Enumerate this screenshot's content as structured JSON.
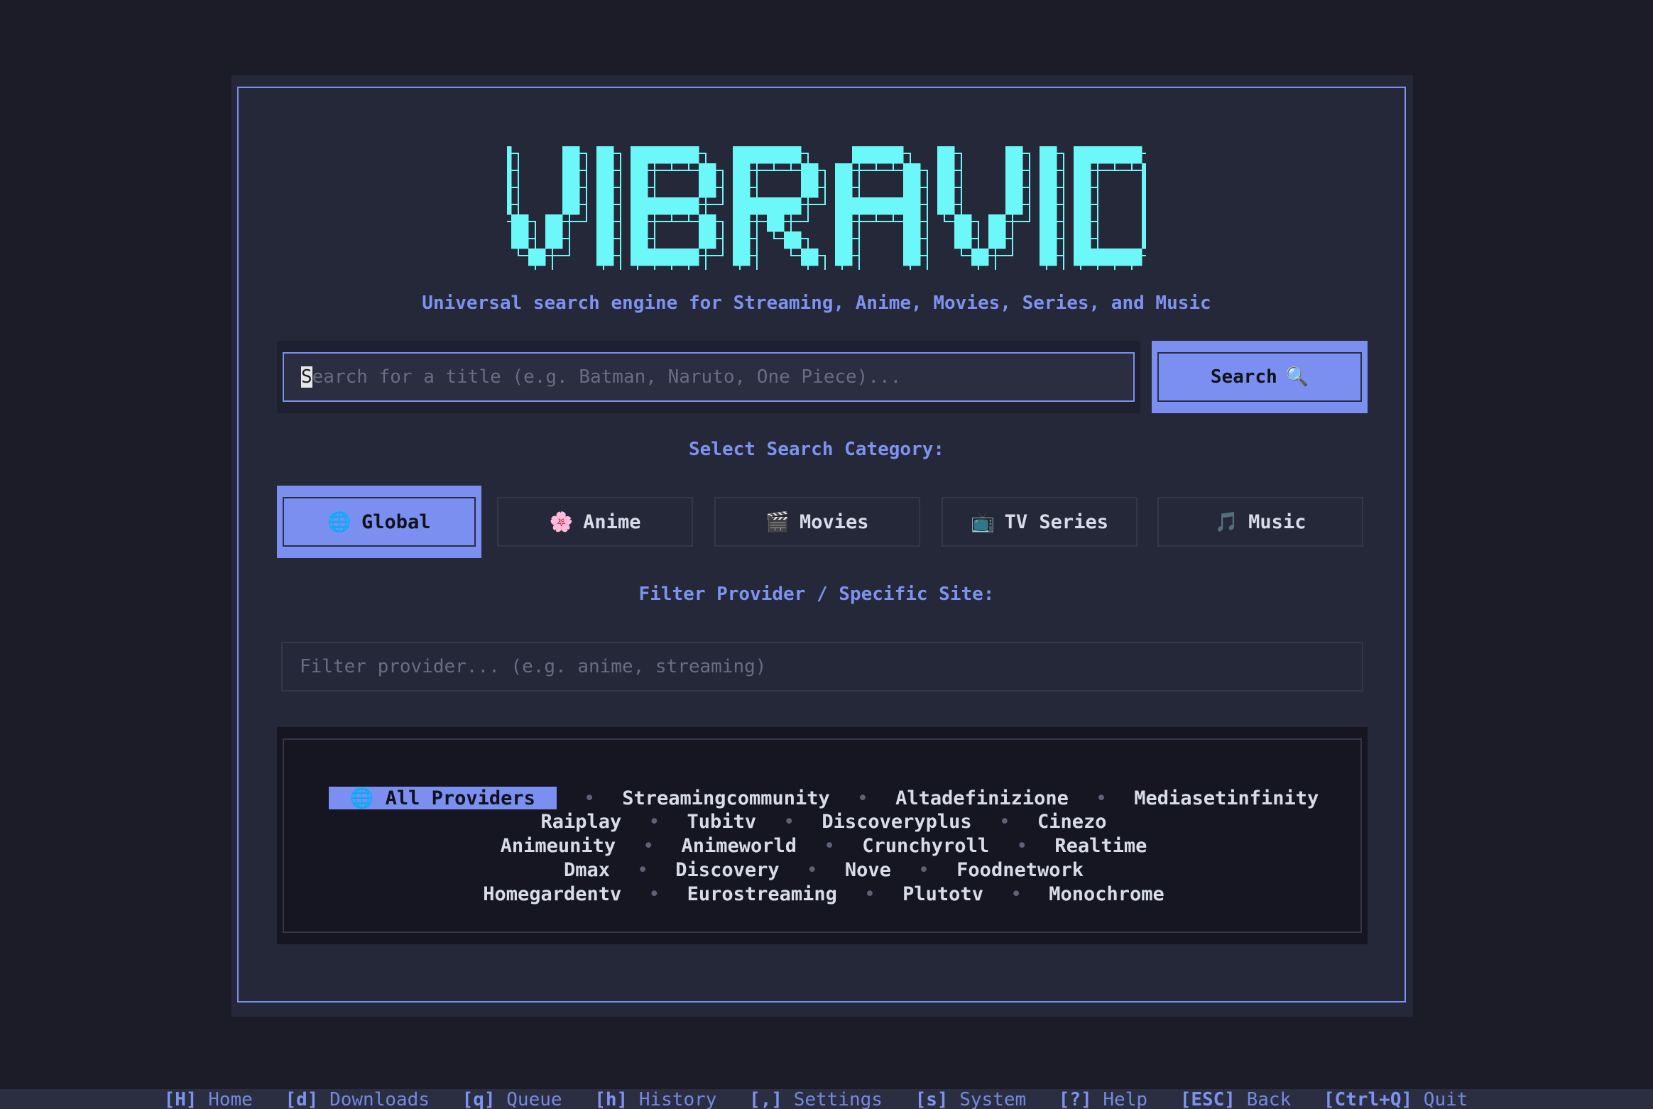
{
  "app": {
    "logo_text": "VIBRAVID",
    "subtitle": "Universal search engine for Streaming, Anime, Movies, Series, and Music"
  },
  "search": {
    "placeholder_first": "S",
    "placeholder_rest": "earch for a title (e.g. Batman, Naruto, One Piece)...",
    "button_label": "Search",
    "button_icon": "🔍"
  },
  "categories": {
    "label": "Select Search Category:",
    "items": [
      {
        "icon": "🌐",
        "label": "Global",
        "active": true
      },
      {
        "icon": "🌸",
        "label": "Anime",
        "active": false
      },
      {
        "icon": "🎬",
        "label": "Movies",
        "active": false
      },
      {
        "icon": "📺",
        "label": "TV Series",
        "active": false
      },
      {
        "icon": "🎵",
        "label": "Music",
        "active": false
      }
    ]
  },
  "filter": {
    "label": "Filter Provider / Specific Site:",
    "placeholder": "Filter provider... (e.g. anime, streaming)"
  },
  "providers": {
    "all_icon": "🌐",
    "all_label": "All Providers",
    "separator": "•",
    "rows": [
      [
        "Streamingcommunity",
        "Altadefinizione",
        "Mediasetinfinity"
      ],
      [
        "Raiplay",
        "Tubitv",
        "Discoveryplus",
        "Cinezo"
      ],
      [
        "Animeunity",
        "Animeworld",
        "Crunchyroll",
        "Realtime"
      ],
      [
        "Dmax",
        "Discovery",
        "Nove",
        "Foodnetwork"
      ],
      [
        "Homegardentv",
        "Eurostreaming",
        "Plutotv",
        "Monochrome"
      ]
    ]
  },
  "footer": [
    {
      "key": "[H]",
      "label": "Home"
    },
    {
      "key": "[d]",
      "label": "Downloads"
    },
    {
      "key": "[q]",
      "label": "Queue"
    },
    {
      "key": "[h]",
      "label": "History"
    },
    {
      "key": "[,]",
      "label": "Settings"
    },
    {
      "key": "[s]",
      "label": "System"
    },
    {
      "key": "[?]",
      "label": "Help"
    },
    {
      "key": "[ESC]",
      "label": "Back"
    },
    {
      "key": "[Ctrl+Q]",
      "label": "Quit"
    }
  ],
  "colors": {
    "accent": "#7b8ff0",
    "logo": "#6cf8f8",
    "background": "#1b1c27",
    "panel": "#252838"
  }
}
